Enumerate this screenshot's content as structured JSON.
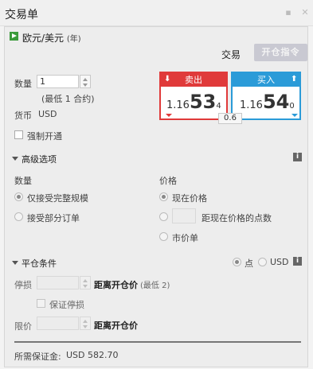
{
  "window": {
    "title": "交易单",
    "pin_icon": "pin-icon",
    "close_icon": "close-icon"
  },
  "instrument": {
    "name": "欧元/美元",
    "suffix": "(年)",
    "icon": "play-icon"
  },
  "header": {
    "trade_tab_label": "交易",
    "open_order_label": "开仓指令"
  },
  "amount": {
    "label": "数量",
    "value": "1",
    "min_note": "(最低 1 合约)"
  },
  "currency": {
    "label": "货币",
    "value": "USD"
  },
  "sell": {
    "label": "卖出",
    "price_prefix": "1.16",
    "price_big": "53",
    "price_pip": "4",
    "color": "#e03a3a"
  },
  "buy": {
    "label": "买入",
    "price_prefix": "1.16",
    "price_big": "54",
    "price_pip": "0",
    "color": "#2b9bd8"
  },
  "spread": "0.6",
  "force_open": {
    "label": "强制开通",
    "checked": false
  },
  "advanced": {
    "title": "高级选项",
    "info_icon": "i",
    "quantity_label": "数量",
    "quantity_options": [
      {
        "label": "仅接受完整规模",
        "checked": true
      },
      {
        "label": "接受部分订单",
        "checked": false
      }
    ],
    "price_label": "价格",
    "price_options": [
      {
        "label": "现在价格",
        "checked": true
      },
      {
        "label": "距现在价格的点数",
        "checked": false
      },
      {
        "label": "市价单",
        "checked": false
      }
    ]
  },
  "close_conditions": {
    "title": "平仓条件",
    "unit_options": [
      {
        "label": "点",
        "checked": true
      },
      {
        "label": "USD",
        "checked": false
      }
    ],
    "info_icon": "i",
    "stop_label": "停损",
    "stop_distance_label": "距离开仓价",
    "stop_min_note": "(最低 2)",
    "guaranteed_stop_label": "保证停损",
    "limit_label": "限价",
    "limit_distance_label": "距离开仓价"
  },
  "margin": {
    "label": "所需保证金:",
    "value": "USD 582.70"
  }
}
